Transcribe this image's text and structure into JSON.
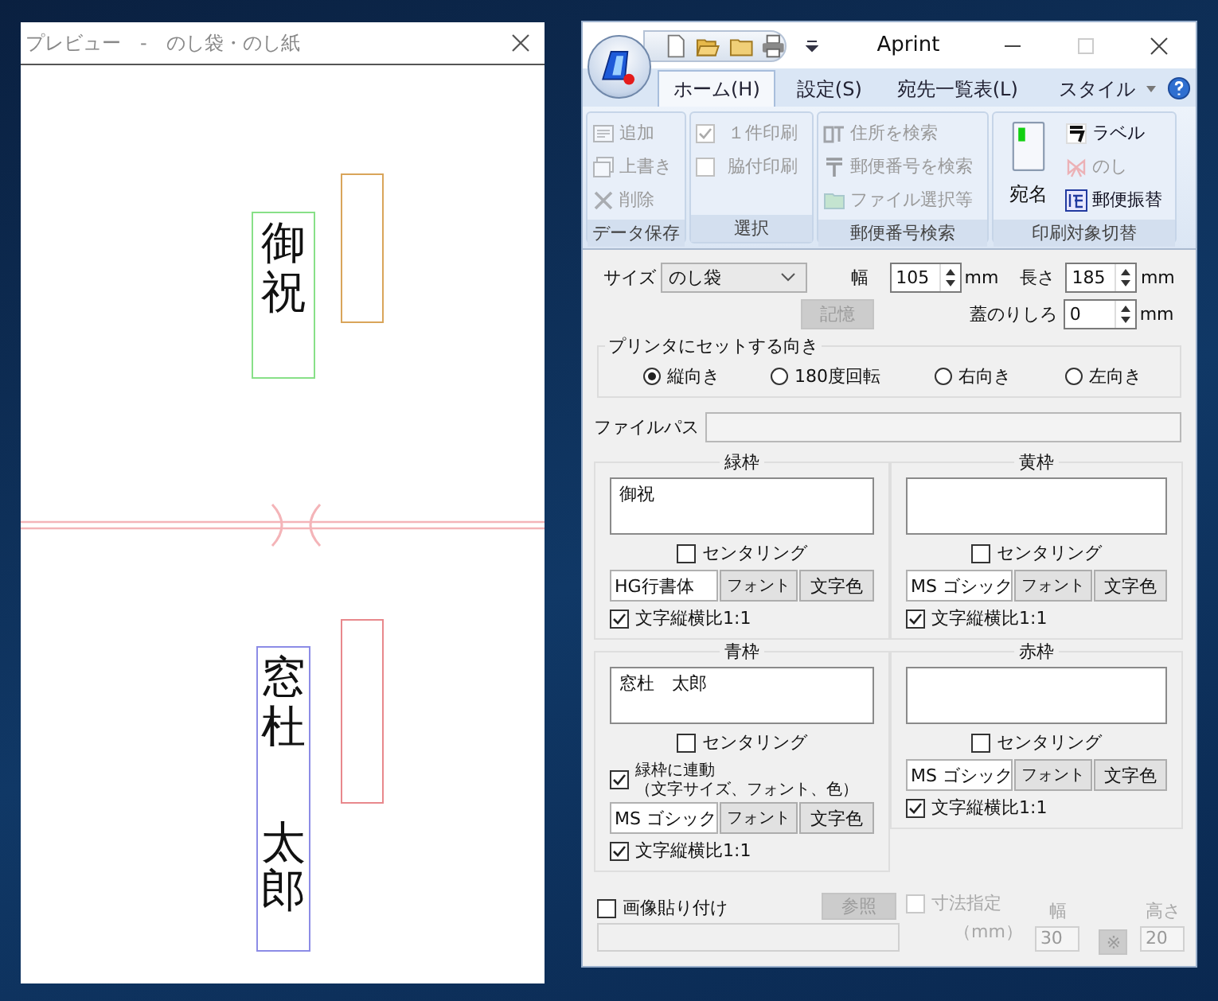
{
  "preview": {
    "title": "プレビュー　-　のし袋・のし紙",
    "frames": [
      {
        "color": "#88e088",
        "lines": [
          "御祝"
        ]
      },
      {
        "color": "#d9a55a"
      },
      {
        "color": "#8c8ce6",
        "lines": [
          "窓杜",
          "太郎"
        ]
      },
      {
        "color": "#e8888c"
      }
    ]
  },
  "app": {
    "title": "Aprint",
    "tabs": [
      {
        "label": "ホーム(H)",
        "selected": true
      },
      {
        "label": "設定(S)",
        "selected": false
      },
      {
        "label": "宛先一覧表(L)",
        "selected": false
      }
    ],
    "style_menu": "スタイル",
    "ribbon": [
      {
        "label": "データ保存",
        "items": [
          {
            "label": "追加",
            "disabled": true
          },
          {
            "label": "上書き",
            "disabled": true
          },
          {
            "label": "削除",
            "disabled": true
          }
        ]
      },
      {
        "label": "選択",
        "items": [
          {
            "label": "１件印刷",
            "checked": true,
            "disabled": true
          },
          {
            "label": "脇付印刷",
            "checked": false,
            "disabled": true
          }
        ]
      },
      {
        "label": "郵便番号検索",
        "items": [
          {
            "label": "住所を検索",
            "disabled": true
          },
          {
            "label": "郵便番号を検索",
            "disabled": true
          },
          {
            "label": "ファイル選択等",
            "disabled": true
          }
        ]
      },
      {
        "label": "印刷対象切替",
        "items": [
          {
            "label": "宛名",
            "disabled": false
          },
          {
            "label": "ラベル",
            "disabled": false
          },
          {
            "label": "のし",
            "disabled": true
          },
          {
            "label": "郵便振替",
            "disabled": false
          }
        ]
      }
    ]
  },
  "form": {
    "size_label": "サイズ",
    "size_value": "のし袋",
    "width_label": "幅",
    "width_value": "105",
    "width_unit": "mm",
    "length_label": "長さ",
    "length_value": "185",
    "length_unit": "mm",
    "memory_button": {
      "label": "記憶",
      "disabled": true
    },
    "flap_label": "蓋のりしろ",
    "flap_value": "0",
    "flap_unit": "mm",
    "orientation": {
      "label": "プリンタにセットする向き",
      "options": [
        {
          "label": "縦向き",
          "selected": true
        },
        {
          "label": "180度回転",
          "selected": false
        },
        {
          "label": "右向き",
          "selected": false
        },
        {
          "label": "左向き",
          "selected": false
        }
      ]
    },
    "file_path_label": "ファイルパス",
    "panels": [
      {
        "title": "緑枠",
        "text": "御祝",
        "centering": {
          "label": "センタリング",
          "checked": false
        },
        "font": "HG行書体",
        "font_button": "フォント",
        "color_button": "文字色",
        "aspect": {
          "label": "文字縦横比1:1",
          "checked": true
        }
      },
      {
        "title": "黄枠",
        "centering": {
          "label": "センタリング",
          "checked": false
        },
        "font": "MS ゴシック",
        "font_button": "フォント",
        "color_button": "文字色",
        "aspect": {
          "label": "文字縦横比1:1",
          "checked": true
        }
      },
      {
        "title": "青枠",
        "text": "窓杜　太郎",
        "centering": {
          "label": "センタリング",
          "checked": false
        },
        "link": {
          "label": "緑枠に連動",
          "note": "（文字サイズ、フォント、色）",
          "checked": true
        },
        "font": "MS ゴシック",
        "font_button": "フォント",
        "color_button": "文字色",
        "aspect": {
          "label": "文字縦横比1:1",
          "checked": true
        }
      },
      {
        "title": "赤枠",
        "centering": {
          "label": "センタリング",
          "checked": false
        },
        "font": "MS ゴシック",
        "font_button": "フォント",
        "color_button": "文字色",
        "aspect": {
          "label": "文字縦横比1:1",
          "checked": true
        }
      }
    ],
    "image": {
      "label": "画像貼り付け",
      "checked": false
    },
    "browse_button": {
      "label": "参照",
      "disabled": true
    },
    "dimension": {
      "label": "寸法指定",
      "checked": false,
      "disabled": true
    },
    "dimension_unit": "（mm）",
    "dim_width_label": "幅",
    "dim_width_value": "30",
    "ratio_button": "※",
    "dim_height_label": "高さ",
    "dim_height_value": "20"
  }
}
